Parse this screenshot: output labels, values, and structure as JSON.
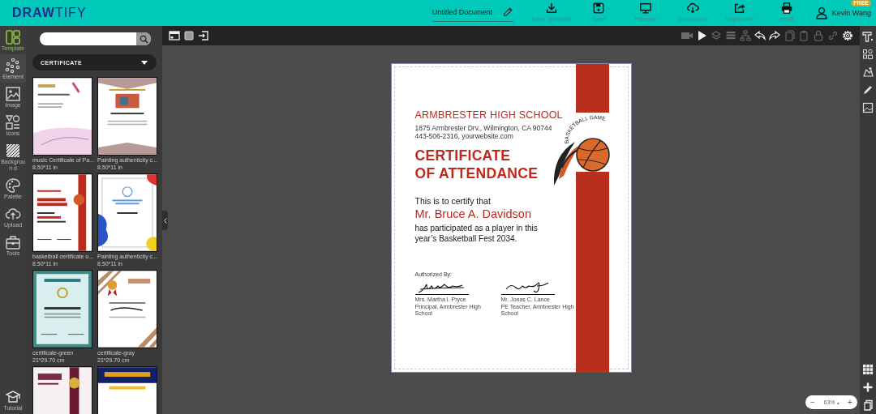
{
  "header": {
    "logo": "**DRAW**TIFY",
    "document_title": "Untitled Document",
    "actions": [
      {
        "kind": "save-template",
        "label": "Save Template"
      },
      {
        "kind": "save",
        "label": "Save"
      },
      {
        "kind": "preview",
        "label": "Preview"
      },
      {
        "kind": "download",
        "label": "Download"
      },
      {
        "kind": "export",
        "label": "Export Ani"
      },
      {
        "kind": "print",
        "label": "Print"
      }
    ],
    "user": {
      "name": "Kevin Wang",
      "badge": "FREE"
    }
  },
  "nav": {
    "items": [
      {
        "kind": "template",
        "label": "Template",
        "selected": true
      },
      {
        "kind": "element",
        "label": "Element",
        "selected": false
      },
      {
        "kind": "image",
        "label": "Image",
        "selected": false
      },
      {
        "kind": "icons",
        "label": "Icons",
        "selected": false
      },
      {
        "kind": "background",
        "label": "Backgroun d",
        "selected": false
      },
      {
        "kind": "palette",
        "label": "Palette",
        "selected": false
      },
      {
        "kind": "upload",
        "label": "Upload",
        "selected": false
      },
      {
        "kind": "tools",
        "label": "Tools",
        "selected": false
      }
    ],
    "tutorial": "Tutorial"
  },
  "panel": {
    "category": "CERTIFICATE",
    "templates": [
      {
        "kind": "music",
        "name": "music Certificate of Pa...",
        "size": "8.50*11 in"
      },
      {
        "kind": "painting",
        "name": "Painting authenticity c...",
        "size": "8.50*11 in"
      },
      {
        "kind": "basketball",
        "name": "basketball certificate o...",
        "size": "8.50*11 in"
      },
      {
        "kind": "abstract",
        "name": "Painting authenticity c...",
        "size": "8.50*11 in"
      },
      {
        "kind": "green",
        "name": "certificate-green",
        "size": "21*29.70 cm"
      },
      {
        "kind": "gray",
        "name": "certificate-gray",
        "size": "21*29.70 cm"
      },
      {
        "kind": "maroon"
      },
      {
        "kind": "navy"
      }
    ]
  },
  "toolbar": {
    "left": [
      {
        "kind": "window",
        "disabled": false
      },
      {
        "kind": "square",
        "disabled": false
      },
      {
        "kind": "enter",
        "disabled": false
      }
    ],
    "right": [
      {
        "kind": "video",
        "disabled": true
      },
      {
        "kind": "play",
        "disabled": false
      },
      {
        "kind": "layers",
        "disabled": true
      },
      {
        "kind": "rows",
        "disabled": true
      },
      {
        "kind": "tree",
        "disabled": true
      },
      {
        "kind": "undo",
        "disabled": false
      },
      {
        "kind": "redo",
        "disabled": false
      },
      {
        "kind": "copy",
        "disabled": true
      },
      {
        "kind": "paste",
        "disabled": true
      },
      {
        "kind": "lock",
        "disabled": true
      },
      {
        "kind": "link",
        "disabled": true
      },
      {
        "kind": "settings",
        "disabled": false
      }
    ]
  },
  "certificate": {
    "school": "ARMBRESTER HIGH SCHOOL",
    "address": [
      "1875 Armbrester Drv., Wilmington, CA 90744",
      "443-506-2316, yourwebsite.com"
    ],
    "title": [
      "CERTIFICATE",
      "OF ATTENDANCE"
    ],
    "badge": "BASKETBALL GAME",
    "intro": "This is to certify that",
    "recipient": "Mr. Bruce A. Davidson",
    "body": [
      "has participated as a player in this",
      "year’s Basketball Fest 2034."
    ],
    "authorized": "Authorized By:",
    "signers": [
      {
        "name": "Mrs. Martha I. Pryce",
        "role": "Principal, Armbrester High School"
      },
      {
        "name": "Mr. Jonas C. Lance",
        "role": "PE Teacher, Armbrester High School"
      }
    ]
  },
  "right_tools": [
    {
      "kind": "text"
    },
    {
      "kind": "shapes"
    },
    {
      "kind": "image-edit"
    },
    {
      "kind": "pen"
    },
    {
      "kind": "photo"
    }
  ],
  "bottom_tools": [
    {
      "kind": "grid"
    },
    {
      "kind": "add"
    },
    {
      "kind": "pages"
    }
  ],
  "zoom": {
    "minus": "−",
    "value": "63%",
    "caret": "▴",
    "plus": "+"
  }
}
